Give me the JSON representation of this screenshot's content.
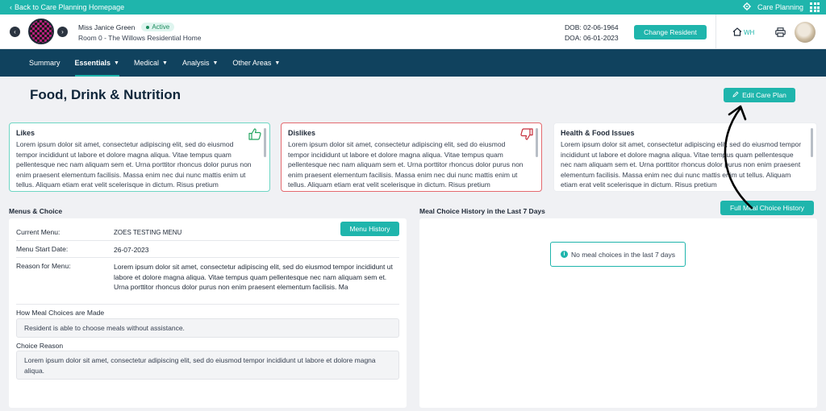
{
  "topbar": {
    "back_label": "Back to Care Planning Homepage",
    "app_label": "Care Planning"
  },
  "resident": {
    "name": "Miss Janice Green",
    "status": "Active",
    "room": "Room 0 - The Willows Residential Home",
    "dob": "DOB: 02-06-1964",
    "doa": "DOA: 06-01-2023",
    "change_label": "Change Resident",
    "home_code": "WH"
  },
  "nav": {
    "items": [
      {
        "label": "Summary"
      },
      {
        "label": "Essentials"
      },
      {
        "label": "Medical"
      },
      {
        "label": "Analysis"
      },
      {
        "label": "Other Areas"
      }
    ]
  },
  "page": {
    "title": "Food, Drink & Nutrition",
    "edit_label": "Edit Care Plan"
  },
  "cards": {
    "likes": {
      "title": "Likes",
      "text": "Lorem ipsum dolor sit amet, consectetur adipiscing elit, sed do eiusmod tempor incididunt ut labore et dolore magna aliqua. Vitae tempus quam pellentesque nec nam aliquam sem et. Urna porttitor rhoncus dolor purus non enim praesent elementum facilisis. Massa enim nec dui nunc mattis enim ut tellus. Aliquam etiam erat velit scelerisque in dictum. Risus pretium"
    },
    "dislikes": {
      "title": "Dislikes",
      "text": "Lorem ipsum dolor sit amet, consectetur adipiscing elit, sed do eiusmod tempor incididunt ut labore et dolore magna aliqua. Vitae tempus quam pellentesque nec nam aliquam sem et. Urna porttitor rhoncus dolor purus non enim praesent elementum facilisis. Massa enim nec dui nunc mattis enim ut tellus. Aliquam etiam erat velit scelerisque in dictum. Risus pretium"
    },
    "health": {
      "title": "Health & Food Issues",
      "text": "Lorem ipsum dolor sit amet, consectetur adipiscing elit, sed do eiusmod tempor incididunt ut labore et dolore magna aliqua. Vitae tempus quam pellentesque nec nam aliquam sem et. Urna porttitor rhoncus dolor purus non enim praesent elementum facilisis. Massa enim nec dui nunc mattis enim ut tellus. Aliquam etiam erat velit scelerisque in dictum. Risus pretium"
    }
  },
  "menus": {
    "title": "Menus & Choice",
    "history_label": "Menu History",
    "current_menu_label": "Current Menu:",
    "current_menu_value": "ZOES TESTING MENU",
    "start_date_label": "Menu Start Date:",
    "start_date_value": "26-07-2023",
    "reason_label": "Reason for Menu:",
    "reason_value": "Lorem ipsum dolor sit amet, consectetur adipiscing elit, sed do eiusmod tempor incididunt ut labore et dolore magna aliqua. Vitae tempus quam pellentesque nec nam aliquam sem et. Urna porttitor rhoncus dolor purus non enim praesent elementum facilisis. Ma",
    "how_label": "How Meal Choices are Made",
    "how_value": "Resident is able to choose meals without assistance.",
    "choice_reason_label": "Choice Reason",
    "choice_reason_value": "Lorem ipsum dolor sit amet, consectetur adipiscing elit, sed do eiusmod tempor incididunt ut labore et dolore magna aliqua."
  },
  "meal_history": {
    "title": "Meal Choice History in the Last 7 Days",
    "full_label": "Full Meal Choice History",
    "empty_text": "No meal choices in the last 7 days"
  },
  "colors": {
    "accent": "#1fb5ac",
    "nav": "#10425e",
    "likes_border": "#6fd6c4",
    "dislikes_border": "#e46a6f"
  },
  "icons": [
    "chevron-left-icon",
    "gear-icon",
    "grid-icon",
    "home-icon",
    "printer-icon",
    "pencil-icon",
    "thumbs-up-icon",
    "thumbs-down-icon",
    "info-icon",
    "annotation-arrow"
  ]
}
